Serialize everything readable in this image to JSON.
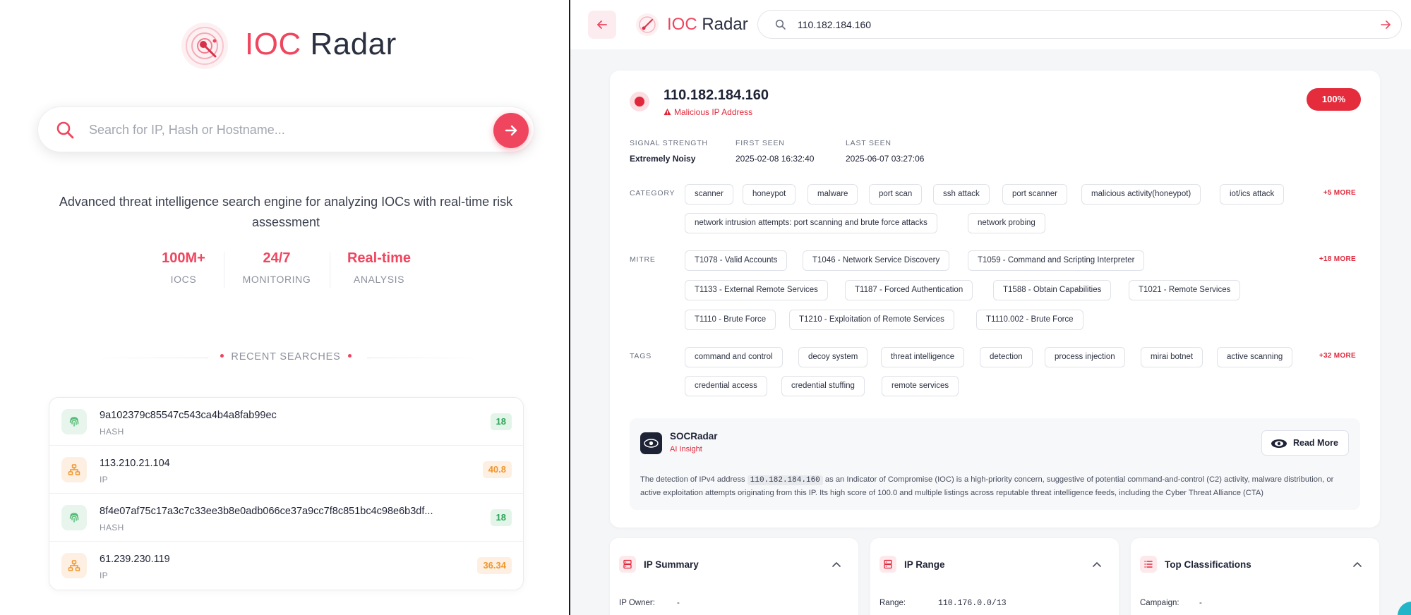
{
  "left": {
    "brand": {
      "ioc": "IOC",
      "radar": "Radar"
    },
    "search": {
      "placeholder": "Search for IP, Hash or Hostname..."
    },
    "tagline": "Advanced threat intelligence search engine for analyzing IOCs with real-time risk assessment",
    "stats": [
      {
        "value": "100M+",
        "label": "IOCS"
      },
      {
        "value": "24/7",
        "label": "MONITORING"
      },
      {
        "value": "Real-time",
        "label": "ANALYSIS"
      }
    ],
    "recent_title": "RECENT SEARCHES",
    "recent": [
      {
        "value": "9a102379c85547c543ca4b4a8fab99ec",
        "type": "HASH",
        "score": "18",
        "score_color": "#2fa55a",
        "icon": "fingerprint-icon"
      },
      {
        "value": "113.210.21.104",
        "type": "IP",
        "score": "40.8",
        "score_color": "#f0962e",
        "icon": "network-icon"
      },
      {
        "value": "8f4e07af75c17a3c7c33ee3b8e0adb066ce37a9cc7f8c851bc4c98e6b3df...",
        "type": "HASH",
        "score": "18",
        "score_color": "#2fa55a",
        "icon": "fingerprint-icon"
      },
      {
        "value": "61.239.230.119",
        "type": "IP",
        "score": "36.34",
        "score_color": "#f0962e",
        "icon": "network-icon"
      }
    ]
  },
  "right": {
    "brand": {
      "ioc": "IOC",
      "radar": "Radar"
    },
    "search_value": "110.182.184.160",
    "header": {
      "ip": "110.182.184.160",
      "subtitle": "Malicious IP Address",
      "score": "100%"
    },
    "meta": [
      {
        "label": "SIGNAL STRENGTH",
        "value": "Extremely Noisy"
      },
      {
        "label": "FIRST SEEN",
        "value": "2025-02-08 16:32:40"
      },
      {
        "label": "LAST SEEN",
        "value": "2025-06-07 03:27:06"
      }
    ],
    "category": {
      "label": "CATEGORY",
      "more": "+5 MORE",
      "chips": [
        "scanner",
        "honeypot",
        "malware",
        "port scan",
        "ssh attack",
        "port scanner",
        "malicious activity(honeypot)",
        "iot/ics attack",
        "network intrusion attempts: port scanning and brute force attacks",
        "network probing"
      ]
    },
    "mitre": {
      "label": "MITRE",
      "more": "+18 MORE",
      "chips": [
        "T1078 - Valid Accounts",
        "T1046 - Network Service Discovery",
        "T1059 - Command and Scripting Interpreter",
        "T1133 - External Remote Services",
        "T1187 - Forced Authentication",
        "T1588 - Obtain Capabilities",
        "T1021 - Remote Services",
        "T1110 - Brute Force",
        "T1210 - Exploitation of Remote Services",
        "T1110.002 - Brute Force"
      ]
    },
    "tags": {
      "label": "TAGS",
      "more": "+32 MORE",
      "chips": [
        "command and control",
        "decoy system",
        "threat intelligence",
        "detection",
        "process injection",
        "mirai botnet",
        "active scanning",
        "credential access",
        "credential stuffing",
        "remote services"
      ]
    },
    "ai": {
      "name": "SOCRadar",
      "sub": "AI Insight",
      "read_more": "Read More",
      "text_before": "The detection of IPv4 address",
      "text_code": "110.182.184.160",
      "text_after": "as an Indicator of Compromise (IOC) is a high-priority concern, suggestive of potential command-and-control (C2) activity, malware distribution, or active exploitation attempts originating from this IP. Its high score of 100.0 and multiple listings across reputable threat intelligence feeds, including the Cyber Threat Alliance (CTA)"
    },
    "panels": [
      {
        "title": "IP Summary",
        "label": "IP Owner:",
        "value": "-"
      },
      {
        "title": "IP Range",
        "label": "Range:",
        "value": "110.176.0.0/13"
      },
      {
        "title": "Top Classifications",
        "label": "Campaign:",
        "value": "-"
      }
    ]
  },
  "colors": {
    "accent": "#f0455e",
    "danger": "#e0283c",
    "safe": "#2fa55a",
    "warn": "#f0962e"
  }
}
